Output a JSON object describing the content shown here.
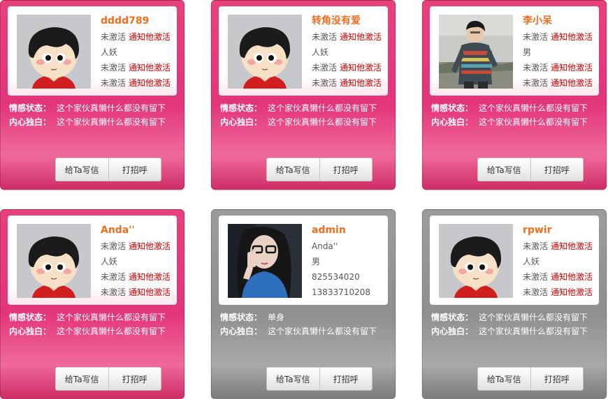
{
  "colors": {
    "pink": "#e3357a",
    "gray": "#9a9a9a",
    "name": "#f06d1e",
    "link": "#cc0000"
  },
  "labels": {
    "feeling": "情感状态：",
    "heart": "内心独白：",
    "write": "给Ta写信",
    "greet": "打招呼"
  },
  "cards": [
    {
      "name": "dddd789",
      "theme": "pink",
      "avatar": "cartoon",
      "rows": [
        {
          "status": "未激活",
          "link": "通知他激活"
        },
        {
          "status": "人妖",
          "link": ""
        },
        {
          "status": "未激活",
          "link": "通知他激活"
        },
        {
          "status": "未激活",
          "link": "通知他激活"
        }
      ],
      "feeling": "这个家伙真懒什么都没有留下",
      "heart": "这个家伙真懒什么都没有留下"
    },
    {
      "name": "转角没有爱",
      "theme": "pink",
      "avatar": "cartoon",
      "rows": [
        {
          "status": "未激活",
          "link": "通知他激活"
        },
        {
          "status": "人妖",
          "link": ""
        },
        {
          "status": "未激活",
          "link": "通知他激活"
        },
        {
          "status": "未激活",
          "link": "通知他激活"
        }
      ],
      "feeling": "这个家伙真懒什么都没有留下",
      "heart": "这个家伙真懒什么都没有留下"
    },
    {
      "name": "李小呆",
      "theme": "pink",
      "avatar": "photo-man",
      "rows": [
        {
          "status": "未激活",
          "link": "通知他激活"
        },
        {
          "status": "男",
          "link": ""
        },
        {
          "status": "未激活",
          "link": "通知他激活"
        },
        {
          "status": "未激活",
          "link": "通知他激活"
        }
      ],
      "feeling": "这个家伙真懒什么都没有留下",
      "heart": "这个家伙真懒什么都没有留下"
    },
    {
      "name": "Anda''",
      "theme": "pink",
      "avatar": "cartoon",
      "rows": [
        {
          "status": "未激活",
          "link": "通知他激活"
        },
        {
          "status": "人妖",
          "link": ""
        },
        {
          "status": "未激活",
          "link": "通知他激活"
        },
        {
          "status": "未激活",
          "link": "通知他激活"
        }
      ],
      "feeling": "这个家伙真懒什么都没有留下",
      "heart": "这个家伙真懒什么都没有留下"
    },
    {
      "name": "admin",
      "theme": "gray",
      "avatar": "photo-woman",
      "rows": [
        {
          "status": "Anda''",
          "link": ""
        },
        {
          "status": "男",
          "link": ""
        },
        {
          "status": "825534020",
          "link": ""
        },
        {
          "status": "13833710208",
          "link": ""
        }
      ],
      "feeling": "单身",
      "heart": "这个家伙真懒什么都没有留下"
    },
    {
      "name": "rpwir",
      "theme": "gray",
      "avatar": "cartoon",
      "rows": [
        {
          "status": "未激活",
          "link": "通知他激活"
        },
        {
          "status": "人妖",
          "link": ""
        },
        {
          "status": "未激活",
          "link": "通知他激活"
        },
        {
          "status": "未激活",
          "link": "通知他激活"
        }
      ],
      "feeling": "这个家伙真懒什么都没有留下",
      "heart": "这个家伙真懒什么都没有留下"
    }
  ]
}
